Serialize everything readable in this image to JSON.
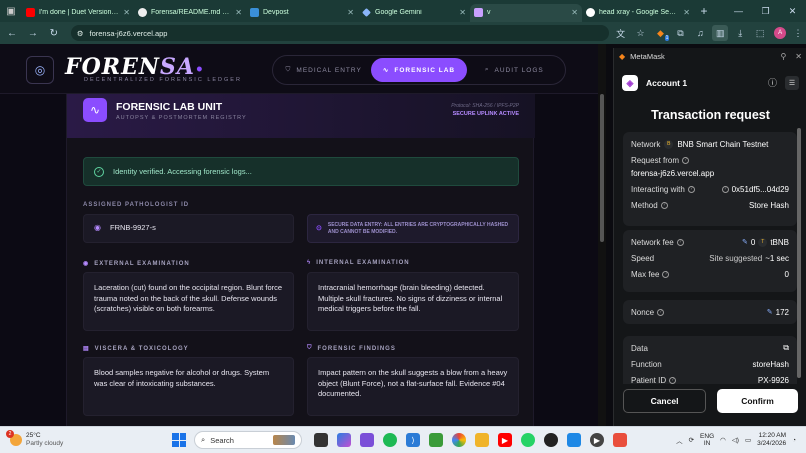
{
  "browser": {
    "tabs": [
      {
        "title": "I'm done | Duet Version | R",
        "icon": "youtube-icon",
        "color": "#ff0000"
      },
      {
        "title": "Forensa/README.md at m",
        "icon": "github-icon",
        "color": "#ffffff"
      },
      {
        "title": "Devpost",
        "icon": "devpost-icon",
        "color": "#3a8fd8"
      },
      {
        "title": "Google Gemini",
        "icon": "gemini-icon",
        "color": "#8ab4f8"
      },
      {
        "title": "v",
        "icon": "vercel-icon",
        "color": "#c9a0ff",
        "active": true
      },
      {
        "title": "head xray - Google Search",
        "icon": "google-icon",
        "color": "#ffffff"
      }
    ],
    "url": "forensa-j6z6.vercel.app",
    "ext_badge": "1",
    "profile_initial": "A"
  },
  "app": {
    "brand_main": "FOREN",
    "brand_accent": "SA",
    "brand_dot": "•",
    "brand_sub": "DECENTRALIZED FORENSIC LEDGER",
    "nav": [
      {
        "label": "MEDICAL ENTRY",
        "icon": "shield-check-icon"
      },
      {
        "label": "FORENSIC LAB",
        "icon": "pulse-icon",
        "active": true
      },
      {
        "label": "AUDIT LOGS",
        "icon": "search-icon"
      }
    ],
    "unit_title": "FORENSIC LAB UNIT",
    "unit_sub": "AUTOPSY & POSTMORTEM REGISTRY",
    "protocol": "Protocol: SHA-256 / IPFS-P2P",
    "uplink": "SECURE UPLINK ACTIVE",
    "verified_msg": "Identity verified. Accessing forensic logs...",
    "pathologist_label": "ASSIGNED PATHOLOGIST ID",
    "pathologist_id": "FRNB-9927-s",
    "secure_note": "SECURE DATA ENTRY: ALL ENTRIES ARE CRYPTOGRAPHICALLY HASHED AND CANNOT BE MODIFIED.",
    "sections": [
      {
        "label": "EXTERNAL EXAMINATION",
        "text": "Laceration (cut) found on the occipital region. Blunt force trauma noted on the back of the skull. Defense wounds (scratches) visible on both forearms."
      },
      {
        "label": "INTERNAL EXAMINATION",
        "text": "Intracranial hemorrhage (brain bleeding) detected. Multiple skull fractures. No signs of dizziness or internal medical triggers before the fall."
      },
      {
        "label": "VISCERA & TOXICOLOGY",
        "text": "Blood samples negative for alcohol or drugs. System was clear of intoxicating substances."
      },
      {
        "label": "FORENSIC FINDINGS",
        "text": "Impact pattern on the skull suggests a blow from a heavy object (Blunt Force), not a flat-surface fall. Evidence #04 documented."
      }
    ]
  },
  "metamask": {
    "app_name": "MetaMask",
    "account": "Account 1",
    "title": "Transaction request",
    "network_label": "Network",
    "network_value": "BNB Smart Chain Testnet",
    "request_from_label": "Request from",
    "request_from_value": "forensa-j6z6.vercel.app",
    "interacting_label": "Interacting with",
    "interacting_value": "0x51df5...04d29",
    "method_label": "Method",
    "method_value": "Store Hash",
    "fee_label": "Network fee",
    "fee_value": "0",
    "fee_unit": "tBNB",
    "speed_label": "Speed",
    "speed_value": "Site suggested",
    "speed_time": "~1 sec",
    "max_fee_label": "Max fee",
    "max_fee_value": "0",
    "nonce_label": "Nonce",
    "nonce_value": "172",
    "data_label": "Data",
    "function_label": "Function",
    "function_value": "storeHash",
    "patient_label": "Patient ID",
    "patient_value": "PX-9926",
    "cancel": "Cancel",
    "confirm": "Confirm"
  },
  "taskbar": {
    "temp": "25°C",
    "weather": "Partly cloudy",
    "weather_badge": "2",
    "search_placeholder": "Search",
    "lang1": "ENG",
    "lang2": "IN",
    "time": "12:20 AM",
    "date": "3/24/2026"
  }
}
